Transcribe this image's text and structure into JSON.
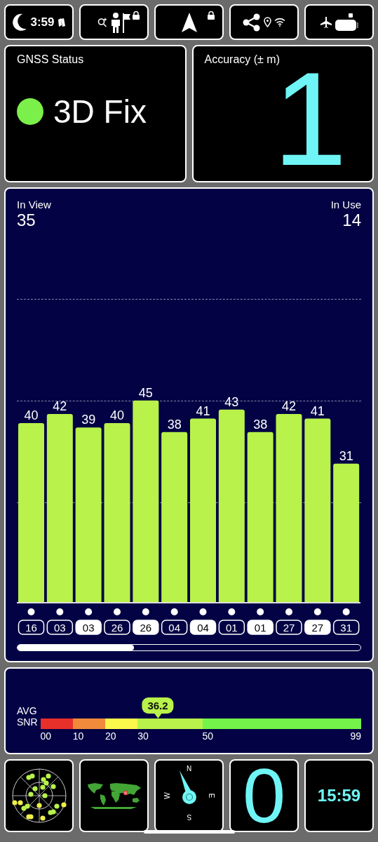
{
  "status_bar": {
    "time": "3:59"
  },
  "gnss_status": {
    "title": "GNSS Status",
    "fix": "3D Fix",
    "fixed": true
  },
  "accuracy": {
    "title": "Accuracy (± m)",
    "value": "1"
  },
  "satellites": {
    "in_view_label": "In View",
    "in_view": "35",
    "in_use_label": "In Use",
    "in_use": "14",
    "chart_data": {
      "type": "bar",
      "categories": [
        "16",
        "03",
        "03",
        "26",
        "26",
        "04",
        "04",
        "01",
        "01",
        "27",
        "27",
        "31"
      ],
      "values": [
        40,
        42,
        39,
        40,
        45,
        38,
        41,
        43,
        38,
        42,
        41,
        31
      ],
      "data_labels": true
    },
    "badge_states": [
      {
        "selected": false
      },
      {
        "selected": false
      },
      {
        "selected": true
      },
      {
        "selected": false
      },
      {
        "selected": true
      },
      {
        "selected": false
      },
      {
        "selected": true
      },
      {
        "selected": false
      },
      {
        "selected": true
      },
      {
        "selected": false
      },
      {
        "selected": true
      },
      {
        "selected": false
      }
    ]
  },
  "snr": {
    "label_top": "AVG",
    "label_bottom": "SNR",
    "average": "36.2",
    "scale": [
      {
        "label": "00",
        "color": "#e8302a"
      },
      {
        "label": "10",
        "color": "#f08a3a"
      },
      {
        "label": "20",
        "color": "#fbf64a"
      },
      {
        "label": "30",
        "color": "#b8f24a"
      },
      {
        "label": "50",
        "color": "#74f34a"
      }
    ],
    "end_label": "99"
  },
  "bottom": {
    "compass": {
      "north": "N",
      "east": "E",
      "south": "S",
      "west": "W"
    },
    "counter": "0",
    "clock": "15:59"
  }
}
